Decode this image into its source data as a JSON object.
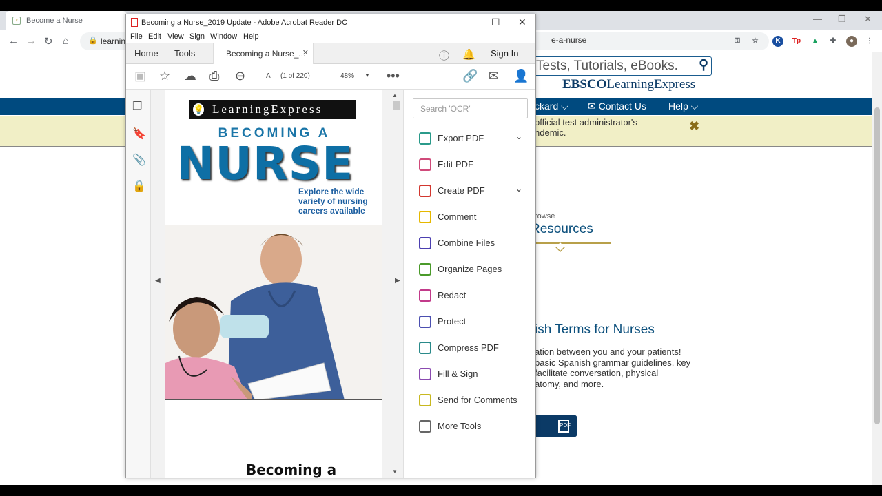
{
  "browser": {
    "tab_title": "Become a Nurse",
    "url_head": "learning",
    "url_tail": "e-a-nurse"
  },
  "website": {
    "search_placeholder": "Tests, Tutorials, eBooks.",
    "logo_bold": "EBSCO",
    "logo_rest": "LearningExpress",
    "nav": [
      {
        "label": "ckard"
      },
      {
        "label": "Contact Us"
      },
      {
        "label": "Help"
      }
    ],
    "alert_lines": [
      "official test administrator's",
      "ndemic."
    ],
    "browse_small": "rowse",
    "browse_heading": "Resources",
    "resource_title": "ish Terms for Nurses",
    "resource_lines": [
      "ation between you and your patients!",
      "basic Spanish grammar guidelines, key",
      " facilitate conversation, physical",
      "atomy, and more."
    ]
  },
  "acrobat": {
    "title": "Becoming a Nurse_2019 Update - Adobe Acrobat Reader DC",
    "menu": [
      "File",
      "Edit",
      "View",
      "Sign",
      "Window",
      "Help"
    ],
    "tabs": {
      "home": "Home",
      "tools": "Tools",
      "doc": "Becoming a Nurse_..."
    },
    "sign_in": "Sign In",
    "page_a": "A",
    "page_count": "(1 of 220)",
    "zoom": "48%",
    "cover": {
      "logo": "LearningExpress",
      "sub": "BECOMING A",
      "title": "NURSE",
      "blurb": "Explore the wide variety of nursing careers available"
    },
    "page2_title": "Becoming a",
    "tools_search_placeholder": "Search 'OCR'",
    "tools": [
      {
        "label": "Export PDF",
        "color": "#2a9a8a",
        "has_chevron": true
      },
      {
        "label": "Edit PDF",
        "color": "#d04a7a",
        "has_chevron": false
      },
      {
        "label": "Create PDF",
        "color": "#d2372f",
        "has_chevron": true
      },
      {
        "label": "Comment",
        "color": "#e6b800",
        "has_chevron": false
      },
      {
        "label": "Combine Files",
        "color": "#4b3fb0",
        "has_chevron": false
      },
      {
        "label": "Organize Pages",
        "color": "#4a9a2a",
        "has_chevron": false
      },
      {
        "label": "Redact",
        "color": "#c23a8a",
        "has_chevron": false
      },
      {
        "label": "Protect",
        "color": "#4b4fb0",
        "has_chevron": false
      },
      {
        "label": "Compress PDF",
        "color": "#2a8a8a",
        "has_chevron": false
      },
      {
        "label": "Fill & Sign",
        "color": "#8a4ab0",
        "has_chevron": false
      },
      {
        "label": "Send for Comments",
        "color": "#c8b820",
        "has_chevron": false
      },
      {
        "label": "More Tools",
        "color": "#666666",
        "has_chevron": false
      }
    ]
  }
}
